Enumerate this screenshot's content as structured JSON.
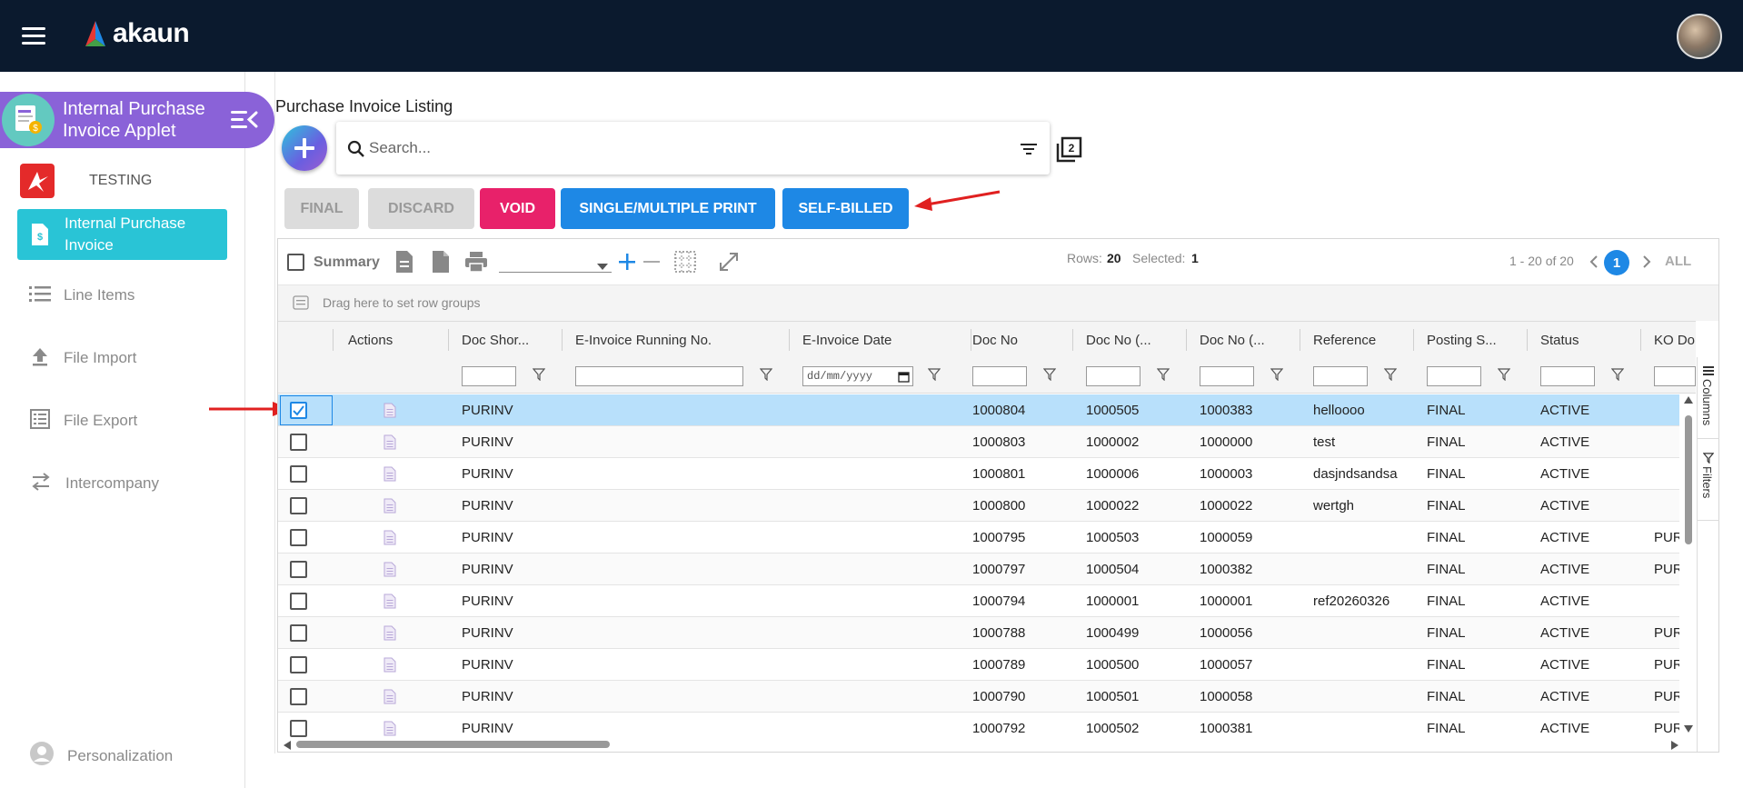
{
  "app": {
    "name": "akaun"
  },
  "sidebar": {
    "applet_title": "Internal Purchase Invoice Applet",
    "company": "TESTING",
    "active_item": "Internal Purchase Invoice",
    "items": [
      {
        "label": "Line Items",
        "icon": "list-icon"
      },
      {
        "label": "File Import",
        "icon": "upload-icon"
      },
      {
        "label": "File Export",
        "icon": "export-list-icon"
      },
      {
        "label": "Intercompany",
        "icon": "swap-arrows-icon"
      }
    ],
    "personalization": "Personalization"
  },
  "page": {
    "title": "Purchase Invoice Listing",
    "search_placeholder": "Search..."
  },
  "actions": {
    "final": "FINAL",
    "discard": "DISCARD",
    "void": "VOID",
    "print": "SINGLE/MULTIPLE PRINT",
    "self_billed": "SELF-BILLED"
  },
  "grid": {
    "summary_label": "Summary",
    "rows_label": "Rows:",
    "rows_count": "20",
    "selected_label": "Selected:",
    "selected_count": "1",
    "pagination_text": "1 - 20 of 20",
    "current_page": "1",
    "all_label": "ALL",
    "group_bar_text": "Drag here to set row groups",
    "date_placeholder": "dd/mm/yyyy",
    "side_tabs": {
      "columns": "Columns",
      "filters": "Filters"
    },
    "columns": [
      "Actions",
      "Doc Shor...",
      "E-Invoice Running No.",
      "E-Invoice Date",
      "Doc No",
      "Doc No (...",
      "Doc No (...",
      "Reference",
      "Posting S...",
      "Status",
      "KO Do"
    ],
    "rows": [
      {
        "selected": true,
        "doc_short": "PURINV",
        "doc_no": "1000804",
        "doc_no_2": "1000505",
        "doc_no_3": "1000383",
        "reference": "helloooo",
        "posting": "FINAL",
        "status": "ACTIVE",
        "ko": ""
      },
      {
        "selected": false,
        "doc_short": "PURINV",
        "doc_no": "1000803",
        "doc_no_2": "1000002",
        "doc_no_3": "1000000",
        "reference": "test",
        "posting": "FINAL",
        "status": "ACTIVE",
        "ko": ""
      },
      {
        "selected": false,
        "doc_short": "PURINV",
        "doc_no": "1000801",
        "doc_no_2": "1000006",
        "doc_no_3": "1000003",
        "reference": "dasjndsandsa",
        "posting": "FINAL",
        "status": "ACTIVE",
        "ko": ""
      },
      {
        "selected": false,
        "doc_short": "PURINV",
        "doc_no": "1000800",
        "doc_no_2": "1000022",
        "doc_no_3": "1000022",
        "reference": "wertgh",
        "posting": "FINAL",
        "status": "ACTIVE",
        "ko": ""
      },
      {
        "selected": false,
        "doc_short": "PURINV",
        "doc_no": "1000795",
        "doc_no_2": "1000503",
        "doc_no_3": "1000059",
        "reference": "",
        "posting": "FINAL",
        "status": "ACTIVE",
        "ko": "PUR"
      },
      {
        "selected": false,
        "doc_short": "PURINV",
        "doc_no": "1000797",
        "doc_no_2": "1000504",
        "doc_no_3": "1000382",
        "reference": "",
        "posting": "FINAL",
        "status": "ACTIVE",
        "ko": "PUR"
      },
      {
        "selected": false,
        "doc_short": "PURINV",
        "doc_no": "1000794",
        "doc_no_2": "1000001",
        "doc_no_3": "1000001",
        "reference": "ref20260326",
        "posting": "FINAL",
        "status": "ACTIVE",
        "ko": ""
      },
      {
        "selected": false,
        "doc_short": "PURINV",
        "doc_no": "1000788",
        "doc_no_2": "1000499",
        "doc_no_3": "1000056",
        "reference": "",
        "posting": "FINAL",
        "status": "ACTIVE",
        "ko": "PUR"
      },
      {
        "selected": false,
        "doc_short": "PURINV",
        "doc_no": "1000789",
        "doc_no_2": "1000500",
        "doc_no_3": "1000057",
        "reference": "",
        "posting": "FINAL",
        "status": "ACTIVE",
        "ko": "PUR"
      },
      {
        "selected": false,
        "doc_short": "PURINV",
        "doc_no": "1000790",
        "doc_no_2": "1000501",
        "doc_no_3": "1000058",
        "reference": "",
        "posting": "FINAL",
        "status": "ACTIVE",
        "ko": "PUR"
      },
      {
        "selected": false,
        "doc_short": "PURINV",
        "doc_no": "1000792",
        "doc_no_2": "1000502",
        "doc_no_3": "1000381",
        "reference": "",
        "posting": "FINAL",
        "status": "ACTIVE",
        "ko": "PUR"
      }
    ]
  },
  "colors": {
    "topbar": "#0b1a2e",
    "applet_purple": "#8a62d8",
    "active_nav": "#29c4d6",
    "void": "#e8216a",
    "primary_blue": "#1e88e5",
    "selected_row": "#b8e0fb",
    "annotation_arrow": "#e02020"
  }
}
